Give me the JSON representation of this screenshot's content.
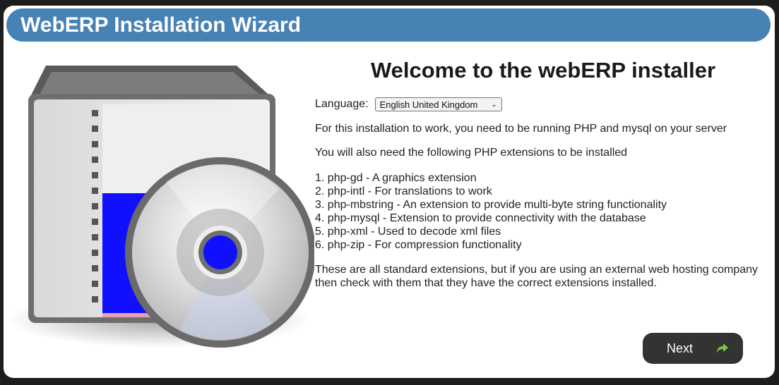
{
  "header": {
    "title": "WebERP Installation Wizard"
  },
  "main": {
    "heading": "Welcome to the webERP installer",
    "language_label": "Language:",
    "language_selected": "English United Kingdom",
    "intro_1": "For this installation to work, you need to be running PHP and mysql on your server",
    "intro_2": "You will also need the following PHP extensions to be installed",
    "extensions": [
      "1. php-gd - A graphics extension",
      "2. php-intl - For translations to work",
      "3. php-mbstring - An extension to provide multi-byte string functionality",
      "4. php-mysql - Extension to provide connectivity with the database",
      "5. php-xml - Used to decode xml files",
      "6. php-zip - For compression functionality"
    ],
    "outro_line1": "These are all standard extensions, but if you are using an external web hosting company",
    "outro_line2": "then check with them that they have the correct extensions installed."
  },
  "footer": {
    "next_label": "Next"
  },
  "icons": {
    "art": "software-install-icon",
    "next": "arrow-forward-icon"
  },
  "colors": {
    "header": "#4682b4",
    "button": "#333333",
    "arrow": "#7ac943",
    "disc_center": "#1a1aff"
  }
}
